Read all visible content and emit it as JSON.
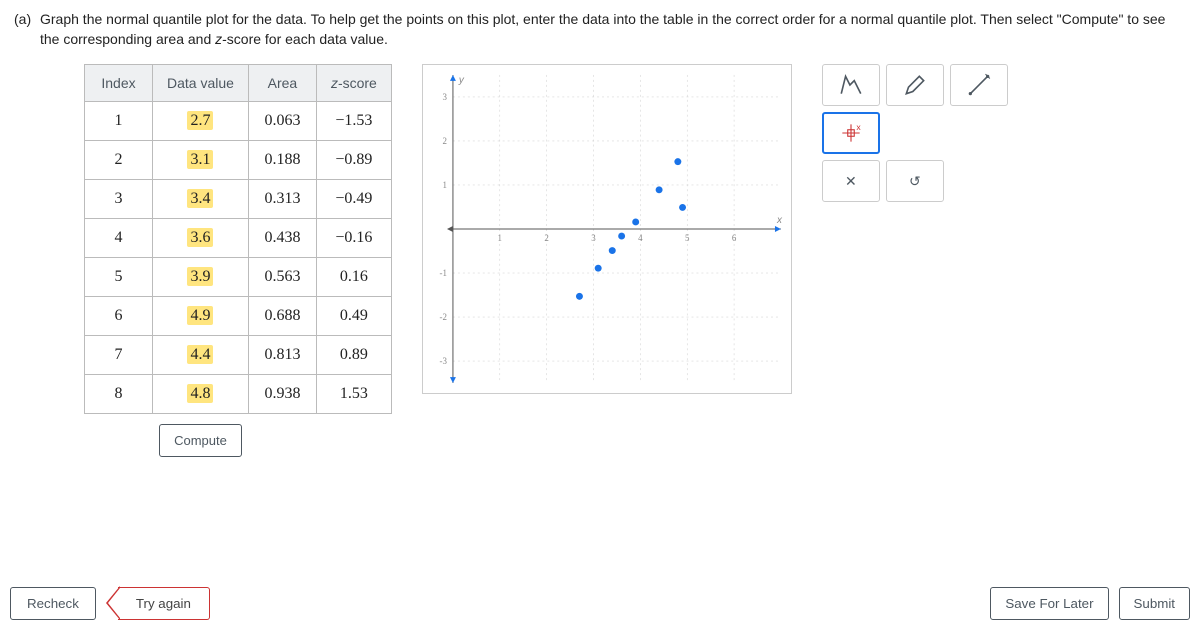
{
  "instruction": {
    "label": "(a)",
    "text_1": "Graph the normal quantile plot for the data. To help get the points on this plot, enter the data into the table in the correct order for a normal quantile plot. Then select \"Compute\" to see the corresponding area and ",
    "zvar": "z",
    "text_2": "-score for each data value."
  },
  "table": {
    "headers": {
      "index": "Index",
      "data_value": "Data value",
      "area": "Area",
      "zscore_pre": "z",
      "zscore_post": "-score"
    },
    "rows": [
      {
        "index": "1",
        "data_value": "2.7",
        "area": "0.063",
        "zscore": "−1.53"
      },
      {
        "index": "2",
        "data_value": "3.1",
        "area": "0.188",
        "zscore": "−0.89"
      },
      {
        "index": "3",
        "data_value": "3.4",
        "area": "0.313",
        "zscore": "−0.49"
      },
      {
        "index": "4",
        "data_value": "3.6",
        "area": "0.438",
        "zscore": "−0.16"
      },
      {
        "index": "5",
        "data_value": "3.9",
        "area": "0.563",
        "zscore": "0.16"
      },
      {
        "index": "6",
        "data_value": "4.9",
        "area": "0.688",
        "zscore": "0.49"
      },
      {
        "index": "7",
        "data_value": "4.4",
        "area": "0.813",
        "zscore": "0.89"
      },
      {
        "index": "8",
        "data_value": "4.8",
        "area": "0.938",
        "zscore": "1.53"
      }
    ],
    "compute_label": "Compute"
  },
  "chart_data": {
    "type": "scatter",
    "xlabel": "x",
    "ylabel": "y",
    "xlim": [
      0,
      7
    ],
    "ylim": [
      -3.5,
      3.5
    ],
    "xticks": [
      1,
      2,
      3,
      4,
      5,
      6
    ],
    "yticks": [
      -3,
      -2,
      -1,
      1,
      2,
      3
    ],
    "points": [
      {
        "x": 2.7,
        "y": -1.53
      },
      {
        "x": 3.1,
        "y": -0.89
      },
      {
        "x": 3.4,
        "y": -0.49
      },
      {
        "x": 3.6,
        "y": -0.16
      },
      {
        "x": 3.9,
        "y": 0.16
      },
      {
        "x": 4.9,
        "y": 0.49
      },
      {
        "x": 4.4,
        "y": 0.89
      },
      {
        "x": 4.8,
        "y": 1.53
      }
    ]
  },
  "toolbox": {
    "select_tool": "select-tool",
    "draw_tool": "draw-tool",
    "line_tool": "line-tool",
    "point_tool": "point-tool",
    "close_tool": "✕",
    "undo_tool": "↺"
  },
  "footer": {
    "recheck": "Recheck",
    "try_again": "Try again",
    "save": "Save For Later",
    "submit": "Submit"
  }
}
